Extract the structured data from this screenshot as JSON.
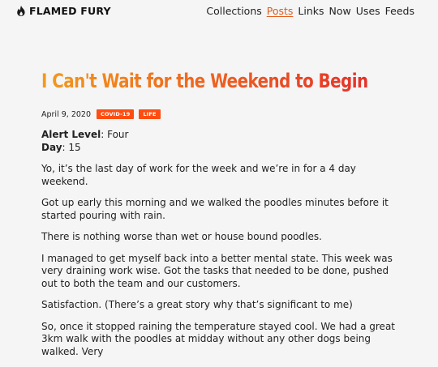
{
  "header": {
    "brand": "FLAMED FURY",
    "nav": [
      "Collections",
      "Posts",
      "Links",
      "Now",
      "Uses",
      "Feeds"
    ],
    "active_nav": "Posts",
    "accent_color": "#e05a1b"
  },
  "post": {
    "title": "I Can't Wait for the Weekend to Begin",
    "date": "April 9, 2020",
    "tags": [
      "COVID-19",
      "LIFE"
    ],
    "tag_color": "#ff4d12",
    "alert_label": "Alert Level",
    "alert_value": ": Four",
    "day_label": "Day",
    "day_value": ": 15",
    "paragraphs": [
      "Yo, it’s the last day of work for the week and we’re in for a 4 day weekend.",
      "Got up early this morning and we walked the poodles minutes before it started pouring with rain.",
      "There is nothing worse than wet or house bound poodles.",
      "I managed to get myself back into a better mental state. This week was very draining work wise. Got the tasks that needed to be done, pushed out to both the team and our customers.",
      "Satisfaction. (There’s a great story why that’s significant to me)",
      "So, once it stopped raining the temperature stayed cool. We had a great 3km walk with the poodles at midday without any other dogs being walked. Very"
    ]
  }
}
